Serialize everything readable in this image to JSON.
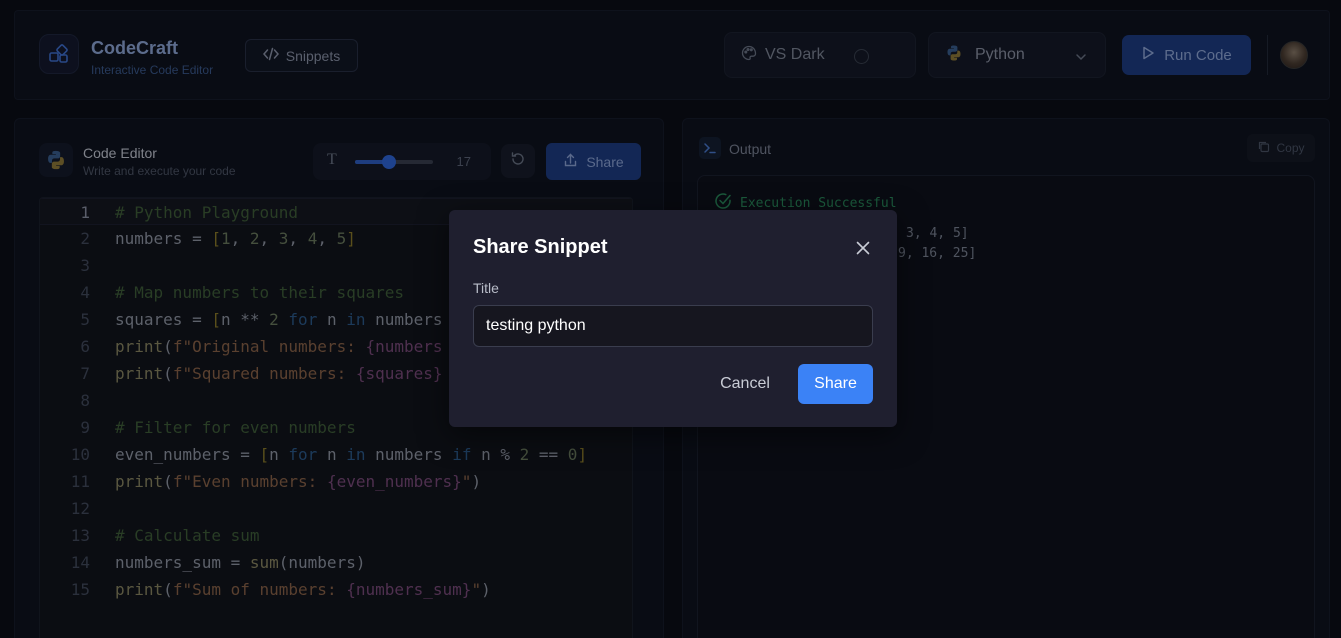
{
  "app": {
    "title": "CodeCraft",
    "subtitle": "Interactive Code Editor",
    "snippets_label": "Snippets",
    "theme_label": "VS Dark",
    "language_label": "Python",
    "run_label": "Run Code"
  },
  "editor": {
    "title": "Code Editor",
    "subtitle": "Write and execute your code",
    "font_size": "17",
    "font_size_fraction": 0.44,
    "share_label": "Share",
    "lines": [
      {
        "n": "1",
        "text": "# Python Playground"
      },
      {
        "n": "2",
        "text": "numbers = [1, 2, 3, 4, 5]"
      },
      {
        "n": "3",
        "text": ""
      },
      {
        "n": "4",
        "text": "# Map numbers to their squares"
      },
      {
        "n": "5",
        "text": "squares = [n ** 2 for n in numbers"
      },
      {
        "n": "6",
        "text": "print(f\"Original numbers: {numbers"
      },
      {
        "n": "7",
        "text": "print(f\"Squared numbers: {squares}"
      },
      {
        "n": "8",
        "text": ""
      },
      {
        "n": "9",
        "text": "# Filter for even numbers"
      },
      {
        "n": "10",
        "text": "even_numbers = [n for n in numbers if n % 2 == 0]"
      },
      {
        "n": "11",
        "text": "print(f\"Even numbers: {even_numbers}\")"
      },
      {
        "n": "12",
        "text": ""
      },
      {
        "n": "13",
        "text": "# Calculate sum"
      },
      {
        "n": "14",
        "text": "numbers_sum = sum(numbers)"
      },
      {
        "n": "15",
        "text": "print(f\"Sum of numbers: {numbers_sum}\")"
      }
    ]
  },
  "output": {
    "title": "Output",
    "copy_label": "Copy",
    "status": "Execution Successful",
    "lines": [
      "3, 4, 5]",
      "9, 16, 25]"
    ]
  },
  "modal": {
    "title": "Share Snippet",
    "field_label": "Title",
    "input_value": "testing python",
    "cancel_label": "Cancel",
    "share_label": "Share"
  },
  "colors": {
    "accent": "#3b82f6",
    "success": "#2a8a5c",
    "background": "#0b0e17"
  },
  "icons": [
    "logo-icon",
    "code-icon",
    "palette-icon",
    "python-icon",
    "chevron-down-icon",
    "play-icon",
    "font-size-icon",
    "reset-icon",
    "share-icon",
    "terminal-icon",
    "copy-icon",
    "check-circle-icon",
    "close-icon"
  ]
}
